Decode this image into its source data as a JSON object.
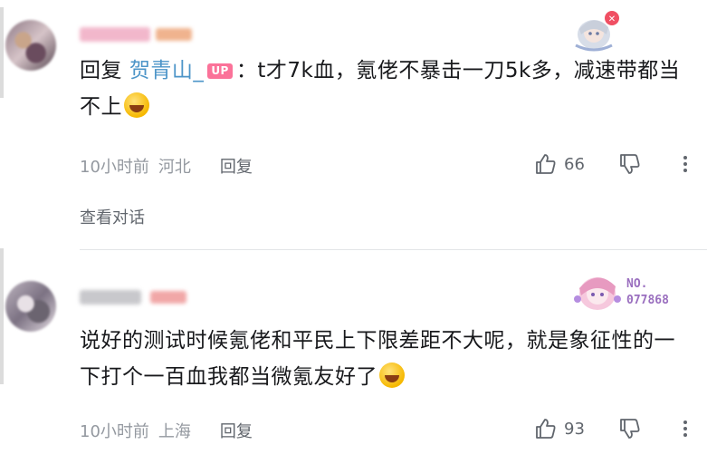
{
  "comments": [
    {
      "reply_prefix": "回复",
      "reply_to": "贺青山_",
      "up_tag": "UP",
      "text": "：t才7k血，氪佬不暴击一刀5k多，减速带都当不上",
      "time": "10小时前",
      "location": "河北",
      "reply_label": "回复",
      "likes": "66",
      "view_thread": "查看对话"
    },
    {
      "text": "说好的测试时候氪佬和平民上下限差距不大呢，就是象征性的一下打个一百血我都当微氪友好了",
      "badge_prefix": "NO.",
      "badge_number": "077868",
      "time": "10小时前",
      "location": "上海",
      "reply_label": "回复",
      "likes": "93"
    }
  ],
  "colors": {
    "accent_link": "#4d95c8",
    "up_tag": "#fb7299",
    "meta_text": "#9499a0"
  }
}
